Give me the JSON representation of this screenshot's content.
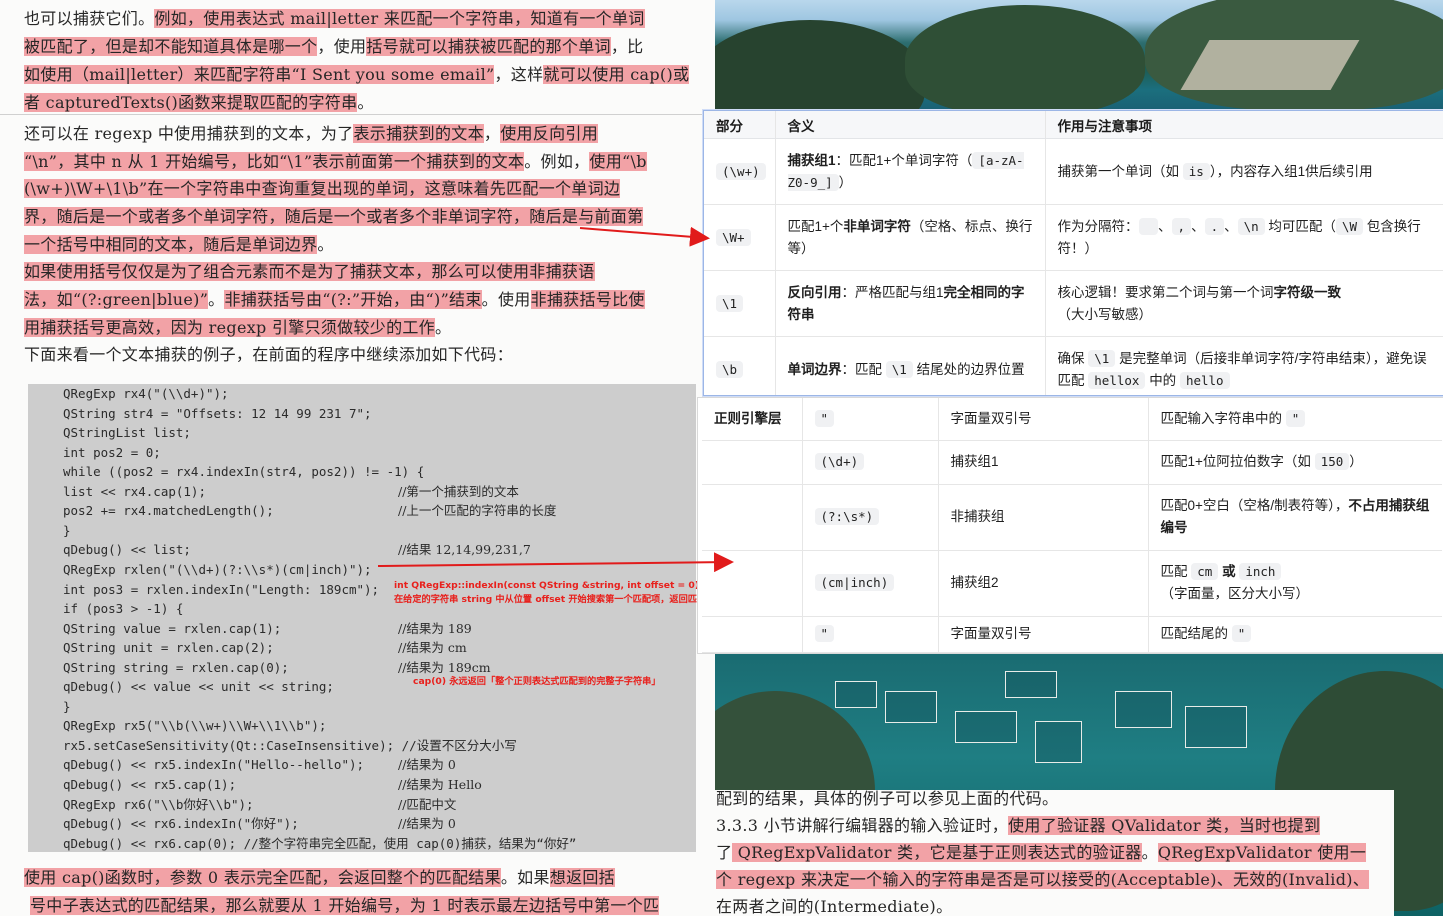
{
  "book_top": {
    "lines": [
      [
        "也可以捕获它们。",
        "例如，使用表达式 mail|letter 来匹配一个字符串，知道有一个单词"
      ],
      [
        "被匹配了，但是却不能知道具体是哪一个",
        "，使用",
        "括号就可以捕获被匹配的那个单词",
        "，比"
      ],
      [
        "如使用（mail|letter）来匹配字符串“I Sent you some email”",
        "，这样",
        "就可以使用 cap()或"
      ],
      [
        "者 capturedTexts()函数来提取匹配的字符串",
        "。"
      ],
      [
        "    还可以在 regexp 中使用捕获到的文本，为了",
        "表示捕获到的文本",
        "，",
        "使用反向引用"
      ],
      [
        "“\\n”，其中 n 从 1 开始编号，比如“\\1”表示前面第一个捕获到的文本",
        "。例如，",
        "使用“\\b"
      ],
      [
        "(\\w+)\\W+\\1\\b”在一个字符串中查询重复出现的单词，这意味着先匹配一个单词边"
      ],
      [
        "界，随后是一个或者多个单词字符，随后是一个或者多个非单词字符，随后是与前面第"
      ],
      [
        "一个括号中相同的文本，随后是单词边界",
        "。"
      ],
      [
        "    ",
        "如果使用括号仅仅是为了组合元素而不是为了捕获文本，那么可以使用非捕获语"
      ],
      [
        "法，如“(?:green|blue)”",
        "。",
        "非捕获括号由“(?:”开始，由“)”结束",
        "。使用",
        "非捕获括号比使"
      ],
      [
        "用捕获括号更高效，因为 regexp 引擎只须做较少的工作",
        "。"
      ],
      [
        "    下面来看一个文本捕获的例子，在前面的程序中继续添加如下代码："
      ]
    ],
    "code_lines": [
      [
        "QRegExp rx4(\"(\\\\d+)\");",
        ""
      ],
      [
        "QString str4 = \"Offsets: 12 14 99 231 7\";",
        ""
      ],
      [
        "QStringList list;",
        ""
      ],
      [
        "int pos2 = 0;",
        ""
      ],
      [
        "while ((pos2 = rx4.indexIn(str4, pos2)) != -1) {",
        ""
      ],
      [
        "list << rx4.cap(1);",
        "//第一个捕获到的文本"
      ],
      [
        "pos2 += rx4.matchedLength();",
        "//上一个匹配的字符串的长度"
      ],
      [
        "}",
        ""
      ],
      [
        "qDebug() << list;",
        "//结果 12,14,99,231,7"
      ],
      [
        "QRegExp rxlen(\"(\\\\d+)(?:\\\\s*)(cm|inch)\");",
        ""
      ],
      [
        "int pos3 = rxlen.indexIn(\"Length: 189cm\");",
        ""
      ],
      [
        "if (pos3 > -1) {",
        ""
      ],
      [
        "QString value = rxlen.cap(1);",
        "//结果为 189"
      ],
      [
        "QString unit = rxlen.cap(2);",
        "//结果为 cm"
      ],
      [
        "QString string = rxlen.cap(0);",
        "//结果为 189cm"
      ],
      [
        "qDebug() << value << unit << string;",
        ""
      ],
      [
        "}",
        ""
      ],
      [
        "QRegExp rx5(\"\\\\b(\\\\w+)\\\\W+\\\\1\\\\b\");",
        ""
      ],
      [
        "rx5.setCaseSensitivity(Qt::CaseInsensitive); //设置不区分大小写",
        ""
      ],
      [
        "qDebug() << rx5.indexIn(\"Hello--hello\");",
        "//结果为 0"
      ],
      [
        "qDebug() << rx5.cap(1);",
        "//结果为 Hello"
      ],
      [
        "QRegExp rx6(\"\\\\b你好\\\\b\");",
        "//匹配中文"
      ],
      [
        "qDebug() << rx6.indexIn(\"你好\");",
        "//结果为 0"
      ],
      [
        "qDebug() << rx6.cap(0); //整个字符串完全匹配，使用 cap(0)捕获，结果为“你好”",
        ""
      ]
    ],
    "annotation_1": "int QRegExp::indexIn(const QString &string, int offset = 0)",
    "annotation_2": "在给定的字符串 string 中从位置 offset 开始搜索第一个匹配项，返回匹配开始的索引位置（以字符为单位）。",
    "annotation_3": "cap(0) 永远返回「整个正则表达式匹配到的完整子字符串」",
    "bottom_lines": [
      [
        "    ",
        "使用 cap()函数时，参数 0 表示完全匹配，会返回整个的匹配结果",
        "。如果",
        "想返回括"
      ],
      [
        "号中子表达式的匹配结果，那么就要从 1 开始编号，为 1 时表示最左边括号中第一个匹"
      ]
    ]
  },
  "table1": {
    "headers": [
      "部分",
      "含义",
      "作用与注意事项"
    ],
    "r1": {
      "part": "(\\w+)",
      "m_bold": "捕获组1",
      "m1": "：匹配1+个单词字符（",
      "m_code": "[a-zA-Z0-9_]",
      "m2": "）",
      "n1": "捕获第一个单词（如",
      "n_code": "is",
      "n2": "），内容存入组1供后续引用"
    },
    "r2": {
      "part": "\\W+",
      "m1": "匹配1+个",
      "m_bold": "非单词字符",
      "m2": "（空格、标点、换行等）",
      "n1": "作为分隔符：",
      "c2": ",",
      "c3": ".",
      "c4": "\\n",
      "n2": "均可匹配（",
      "c5": "\\W",
      "n3": "包含换行符！）",
      "sep": "、"
    },
    "r3": {
      "part": "\\1",
      "m_bold": "反向引用",
      "m1": "：严格匹配与组1",
      "m_bold2": "完全相同的字符串",
      "n1": "核心逻辑！要求第二个词与第一个词",
      "n_bold": "字符级一致",
      "n2": "（大小写敏感）"
    },
    "r4": {
      "part": "\\b",
      "m_bold": "单词边界",
      "m1": "：匹配",
      "m_code": "\\1",
      "m2": "结尾处的边界位置",
      "n1": "确保",
      "n_code": "\\1",
      "n2": "是完整单词（后接非单词字符/字符串结束），避免误匹配",
      "n_code2": "hellox",
      "n3": "中的",
      "n_code3": "hello"
    }
  },
  "table2": {
    "rows": [
      {
        "layer": "正则引擎层",
        "part": "\"",
        "meaning": "字面量双引号",
        "n1": "匹配输入字符串中的",
        "n_code": "\""
      },
      {
        "layer": "",
        "part": "(\\d+)",
        "meaning": "捕获组1",
        "n1": "匹配1+位阿拉伯数字（如",
        "n_code": "150",
        "n2": "）"
      },
      {
        "layer": "",
        "part": "(?:\\s*)",
        "meaning": "非捕获组",
        "n1": "匹配0+空白（空格/制表符等），",
        "n_bold": "不占用捕获组编号"
      },
      {
        "layer": "",
        "part": "(cm|inch)",
        "meaning": "捕获组2",
        "n1": "匹配",
        "n_code": "cm",
        "n_bold": "或",
        "n_code2": "inch",
        "n2": "（字面量，区分大小写）"
      },
      {
        "layer": "",
        "part": "\"",
        "meaning": "字面量双引号",
        "n1": "匹配结尾的",
        "n_code": "\""
      }
    ]
  },
  "book_right": {
    "lines": [
      [
        "配到的结果，具体的例子可以参见上面的代码。"
      ],
      [
        "    3.3.3 小节讲解行编辑器的输入验证时，",
        "使用了验证器 QValidator 类，当时也提到"
      ],
      [
        "了",
        " QRegExpValidator 类，它是基于正则表达式的验证器",
        "。",
        "QRegExpValidator 使用一"
      ],
      [
        "个",
        " regexp 来决定一个输入的字符串是否是可以接受的(Acceptable)、无效的(Invalid)、"
      ],
      [
        "在两者之间的(Intermediate)。"
      ]
    ]
  },
  "colors": {
    "highlight": "#f2a2a6",
    "annotation_red": "#e8201c",
    "arrow_red": "#e11b1b"
  }
}
